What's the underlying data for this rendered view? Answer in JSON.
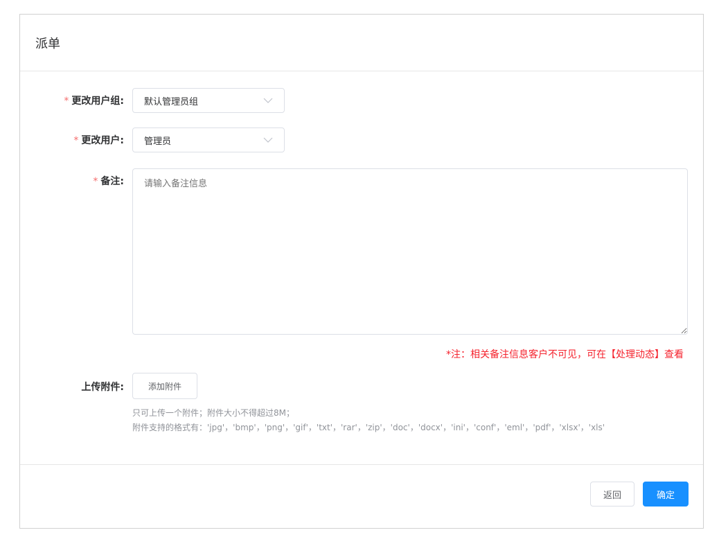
{
  "dialog": {
    "title": "派单"
  },
  "form": {
    "user_group": {
      "required_mark": "*",
      "label": "更改用户组:",
      "value": "默认管理员组"
    },
    "user": {
      "required_mark": "*",
      "label": "更改用户:",
      "value": "管理员"
    },
    "remark": {
      "required_mark": "*",
      "label": "备注:",
      "placeholder": "请输入备注信息",
      "note": "*注：相关备注信息客户不可见，可在【处理动态】查看"
    },
    "attachment": {
      "label": "上传附件:",
      "button": "添加附件",
      "hint_line1": "只可上传一个附件；附件大小不得超过8M；",
      "hint_line2": "附件支持的格式有：'jpg'，'bmp'，'png'，'gif'，'txt'，'rar'，'zip'，'doc'，'docx'，'ini'，'conf'，'eml'，'pdf'，'xlsx'，'xls'"
    }
  },
  "footer": {
    "back_label": "返回",
    "confirm_label": "确定"
  },
  "icons": {
    "dropdown": "chevron-down-icon",
    "resize": "resize-handle-icon"
  },
  "colors": {
    "primary": "#1890ff",
    "required": "#f56c6c",
    "note": "#f5222d"
  }
}
